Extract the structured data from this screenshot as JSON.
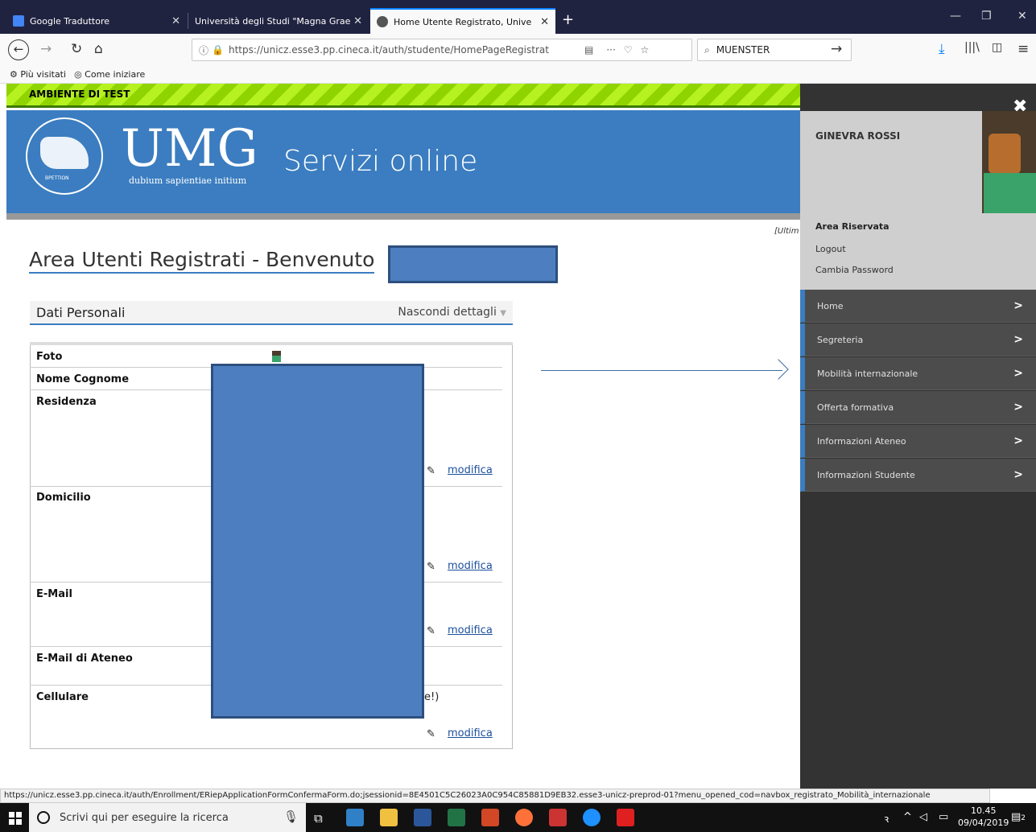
{
  "browser": {
    "tabs": [
      {
        "label": "Google Traduttore"
      },
      {
        "label": "Università degli Studi \"Magna Grae"
      },
      {
        "label": "Home Utente Registrato, Unive"
      }
    ],
    "url": "https://unicz.esse3.pp.cineca.it/auth/studente/HomePageRegistrat",
    "search_value": "MUENSTER",
    "bookmarks": [
      "Più visitati",
      "Come iniziare"
    ],
    "status_url": "https://unicz.esse3.pp.cineca.it/auth/Enrollment/ERiepApplicationFormConfermaForm.do;jsessionid=8E4501C5C26023A0C954C85881D9EB32.esse3-unicz-preprod-01?menu_opened_cod=navbox_registrato_Mobilità_internazionale"
  },
  "page": {
    "test_banner": "AMBIENTE DI TEST",
    "logo_text": "UMG",
    "logo_motto": "dubium sapientiae initium",
    "logo_seal": "BPETTIΩN",
    "site_title": "Servizi online",
    "ultim_text": "[Ultim",
    "title": "Area Utenti Registrati - Benvenuto",
    "section_title": "Dati Personali",
    "hide_details": "Nascondi dettagli",
    "rows": {
      "foto": "Foto",
      "nome": "Nome Cognome",
      "residenza": "Residenza",
      "domicilio": "Domicilio",
      "email": "E-Mail",
      "email_ateneo": "E-Mail di Ateneo",
      "cellulare": "Cellulare",
      "cell_fragment": "e!)"
    },
    "modify_label": "modifica"
  },
  "side": {
    "user_name": "GINEVRA ROSSI",
    "area_label": "Area Riservata",
    "logout": "Logout",
    "change_password": "Cambia Password",
    "menu": [
      {
        "label": "Home"
      },
      {
        "label": "Segreteria"
      },
      {
        "label": "Mobilità internazionale"
      },
      {
        "label": "Offerta formativa"
      },
      {
        "label": "Informazioni Ateneo"
      },
      {
        "label": "Informazioni Studente"
      }
    ]
  },
  "taskbar": {
    "search_placeholder": "Scrivi qui per eseguire la ricerca",
    "time": "10.45",
    "date": "09/04/2019",
    "notification_count": "2"
  },
  "colors": {
    "accent": "#3b7dc0",
    "test_banner": "#9ee000",
    "side_bg": "#333333"
  }
}
